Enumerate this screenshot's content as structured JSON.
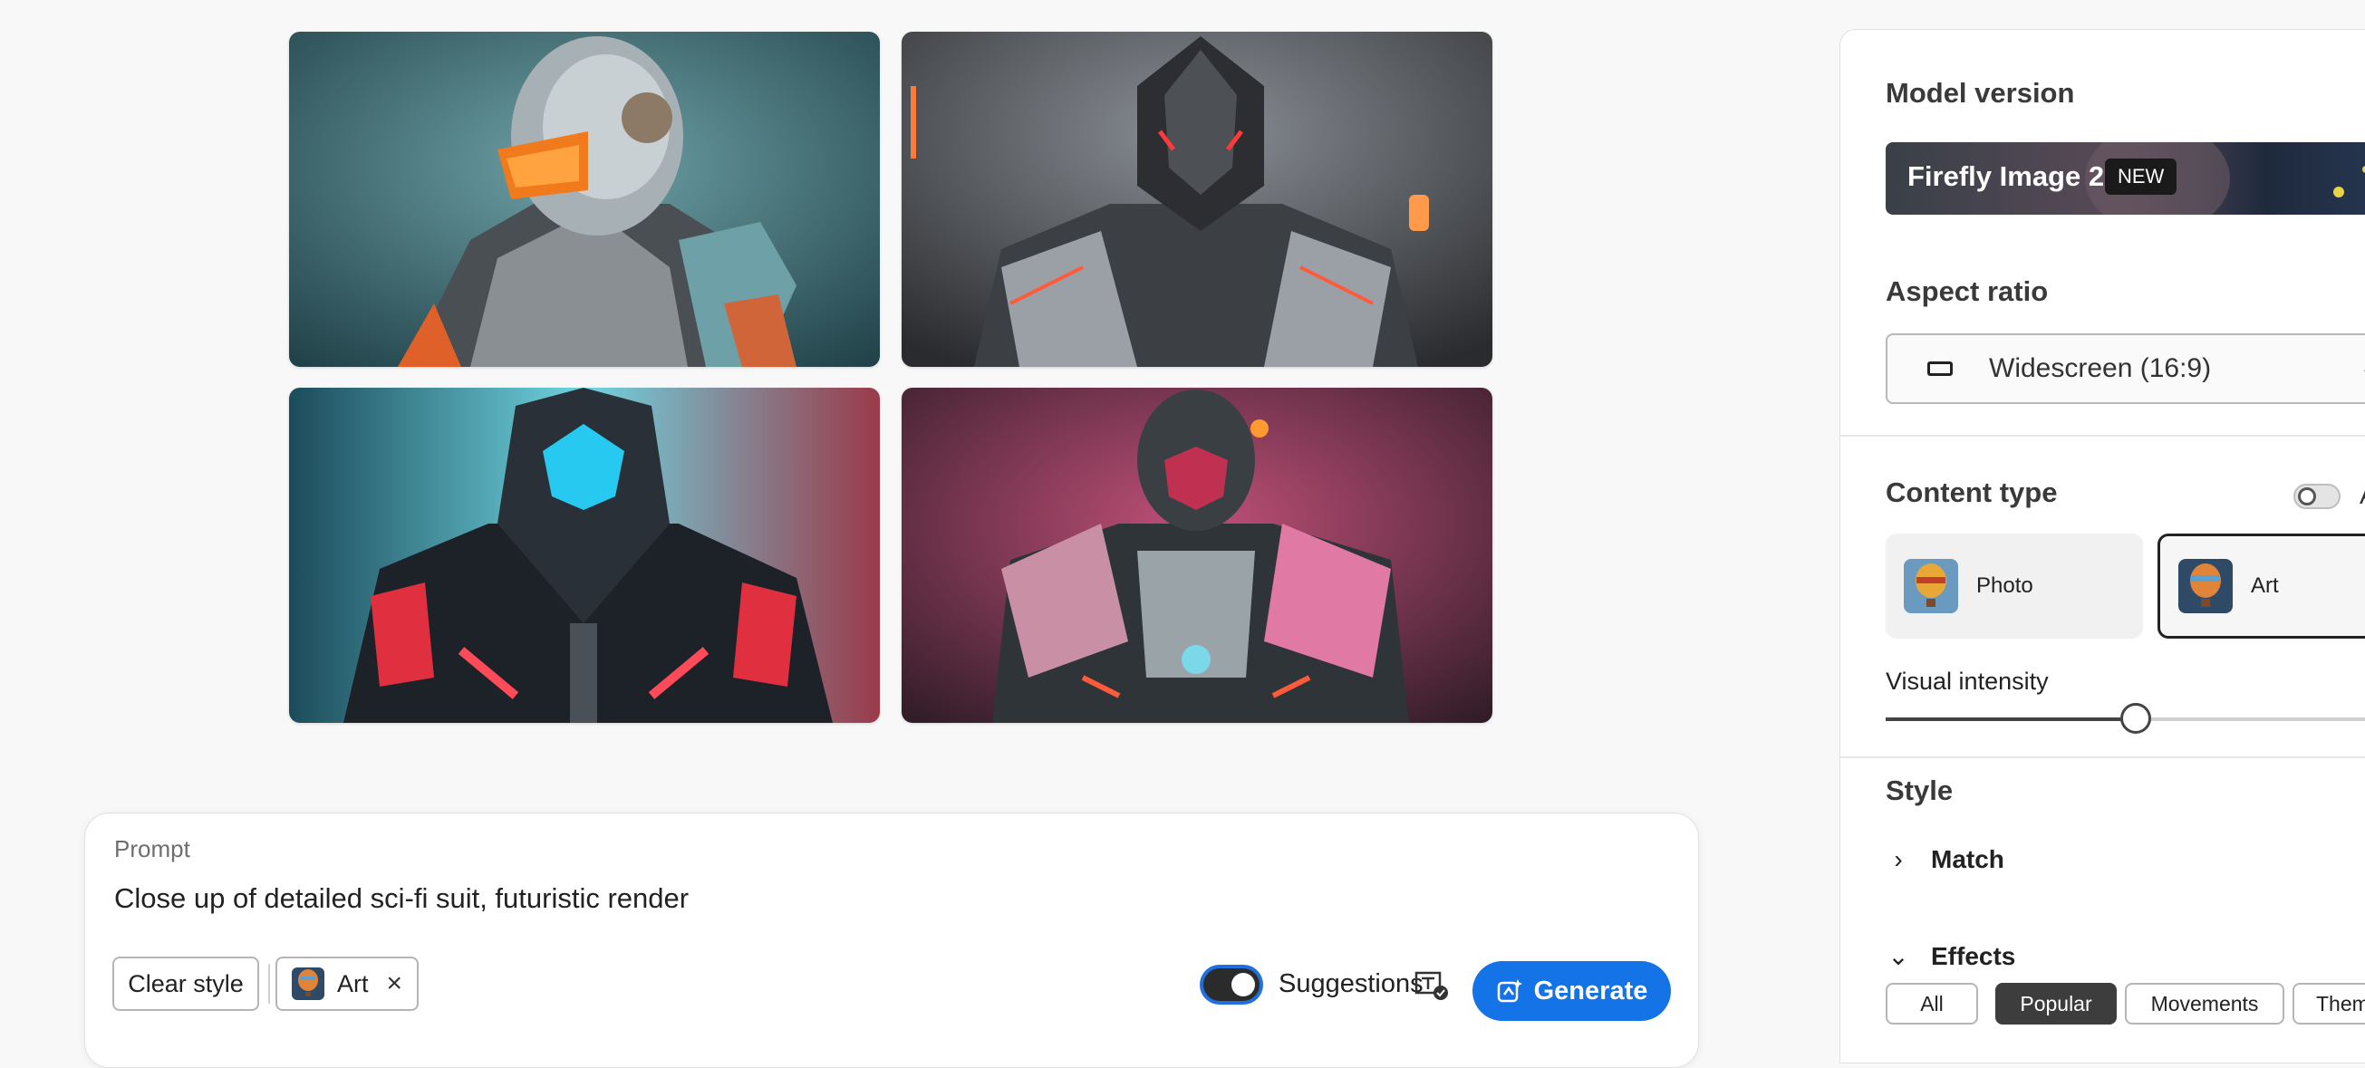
{
  "gallery": {
    "images": [
      {
        "alt": "sci-fi suit image 1"
      },
      {
        "alt": "sci-fi suit image 2"
      },
      {
        "alt": "sci-fi suit image 3"
      },
      {
        "alt": "sci-fi suit image 4"
      }
    ]
  },
  "prompt": {
    "label": "Prompt",
    "text": "Close up of detailed sci-fi suit, futuristic render",
    "clear_style_label": "Clear style",
    "style_chip_label": "Art",
    "chip_close": "×",
    "suggestions_label": "Suggestions",
    "suggestions_on": true,
    "generate_label": "Generate"
  },
  "panel": {
    "model_version": {
      "title": "Model version",
      "model_name": "Firefly Image 2",
      "badge": "NEW"
    },
    "aspect_ratio": {
      "title": "Aspect ratio",
      "value": "Widescreen (16:9)",
      "chevron": "⌄"
    },
    "content_type": {
      "title": "Content type",
      "toggle_label": "A",
      "options": [
        {
          "label": "Photo",
          "selected": false
        },
        {
          "label": "Art",
          "selected": true
        }
      ]
    },
    "visual_intensity": {
      "label": "Visual intensity",
      "value_fraction": 0.46
    },
    "style": {
      "title": "Style",
      "match_label": "Match",
      "effects_label": "Effects",
      "pills": [
        {
          "label": "All",
          "active": false
        },
        {
          "label": "Popular",
          "active": true
        },
        {
          "label": "Movements",
          "active": false
        },
        {
          "label": "Them",
          "active": false
        }
      ]
    }
  },
  "colors": {
    "accent": "#1473e6",
    "selected_pill": "#3d3d3d"
  }
}
